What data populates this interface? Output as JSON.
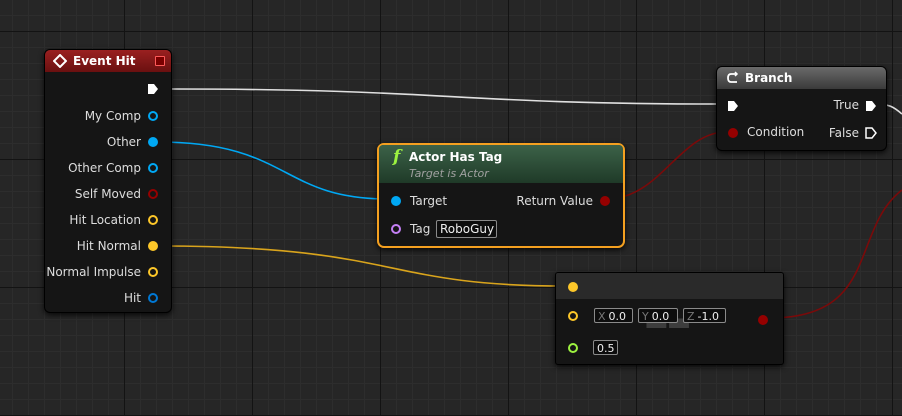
{
  "nodes": {
    "event_hit": {
      "title": "Event Hit",
      "pins": [
        "My Comp",
        "Other",
        "Other Comp",
        "Self Moved",
        "Hit Location",
        "Hit Normal",
        "Normal Impulse",
        "Hit"
      ]
    },
    "branch": {
      "title": "Branch",
      "condition_label": "Condition",
      "true_label": "True",
      "false_label": "False"
    },
    "actor_has_tag": {
      "title": "Actor Has Tag",
      "subtitle": "Target is Actor",
      "target_label": "Target",
      "tag_label": "Tag",
      "tag_value": "RoboGuy",
      "return_label": "Return Value"
    },
    "vector_node": {
      "x_label": "X",
      "x_value": "0.0",
      "y_label": "Y",
      "y_value": "0.0",
      "z_label": "Z",
      "z_value": "-1.0",
      "scalar_value": "0.5"
    }
  },
  "colors": {
    "exec": "#ffffff",
    "object": "#00a8f4",
    "bool": "#950000",
    "vector": "#fdc729",
    "float": "#9df240",
    "name": "#c580f6",
    "event_header": "#8a1a1a",
    "function_header": "#274833",
    "branch_header": "#555555",
    "selection": "#f4a020"
  }
}
